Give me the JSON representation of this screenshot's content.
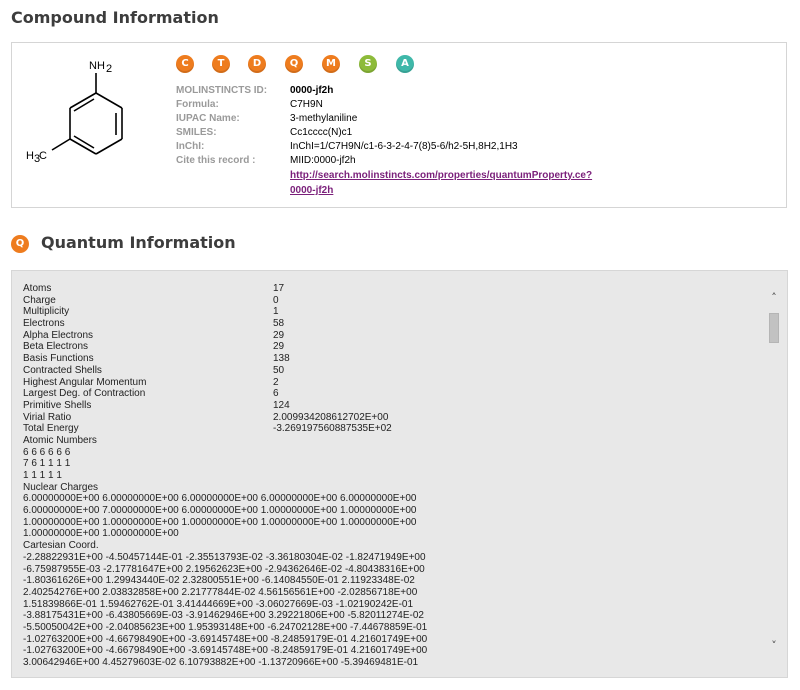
{
  "compound_section": {
    "title": "Compound Information"
  },
  "molecule": {
    "nh2_label": "NH",
    "nh2_sub": "2",
    "ch3_label": "H",
    "ch3_sub": "3",
    "ch3_c": "C"
  },
  "badges": [
    {
      "letter": "C",
      "color": "#ee7c1e"
    },
    {
      "letter": "T",
      "color": "#ee7c1e"
    },
    {
      "letter": "D",
      "color": "#ee7c1e"
    },
    {
      "letter": "Q",
      "color": "#ee7c1e"
    },
    {
      "letter": "M",
      "color": "#ee7c1e"
    },
    {
      "letter": "S",
      "color": "#8dbb3a"
    },
    {
      "letter": "A",
      "color": "#3fb8a9"
    }
  ],
  "info": {
    "molinstincts_id_label": "MOLINSTINCTS ID:",
    "molinstincts_id": "0000-jf2h",
    "formula_label": "Formula:",
    "formula": "C7H9N",
    "iupac_label": "IUPAC Name:",
    "iupac": "3-methylaniline",
    "smiles_label": "SMILES:",
    "smiles": "Cc1cccc(N)c1",
    "inchi_label": "InChI:",
    "inchi": "InChI=1/C7H9N/c1-6-3-2-4-7(8)5-6/h2-5H,8H2,1H3",
    "cite_label": "Cite this record :",
    "cite": "MIID:0000-jf2h",
    "link_line1": "http://search.molinstincts.com/properties/quantumProperty.ce?",
    "link_line2": "0000-jf2h"
  },
  "quantum_section": {
    "icon_letter": "Q",
    "title": "Quantum Information"
  },
  "quantum": {
    "rows": [
      {
        "key": "Atoms",
        "value": "17"
      },
      {
        "key": "Charge",
        "value": "0"
      },
      {
        "key": "Multiplicity",
        "value": "1"
      },
      {
        "key": "Electrons",
        "value": "58"
      },
      {
        "key": "Alpha Electrons",
        "value": "29"
      },
      {
        "key": "Beta Electrons",
        "value": "29"
      },
      {
        "key": "Basis Functions",
        "value": "138"
      },
      {
        "key": "Contracted Shells",
        "value": "50"
      },
      {
        "key": "Highest Angular Momentum",
        "value": "2"
      },
      {
        "key": "Largest Deg. of Contraction",
        "value": "6"
      },
      {
        "key": "Primitive Shells",
        "value": "124"
      },
      {
        "key": "Virial Ratio",
        "value": "2.009934208612702E+00"
      },
      {
        "key": "Total Energy",
        "value": "-3.269197560887535E+02"
      }
    ],
    "atomic_numbers_label": "Atomic Numbers",
    "atomic_numbers": [
      "6 6 6 6 6 6",
      "7 6 1 1 1 1",
      "1 1 1 1 1"
    ],
    "nuclear_charges_label": "Nuclear Charges",
    "nuclear_charges": [
      "6.00000000E+00 6.00000000E+00 6.00000000E+00 6.00000000E+00 6.00000000E+00",
      "6.00000000E+00 7.00000000E+00 6.00000000E+00 1.00000000E+00 1.00000000E+00",
      "1.00000000E+00 1.00000000E+00 1.00000000E+00 1.00000000E+00 1.00000000E+00",
      "1.00000000E+00 1.00000000E+00"
    ],
    "cartesian_label": "Cartesian Coord.",
    "cartesian": [
      "-2.28822931E+00 -4.50457144E-01 -2.35513793E-02 -3.36180304E-02 -1.82471949E+00",
      "-6.75987955E-03 -2.17781647E+00 2.19562623E+00 -2.94362646E-02 -4.80438316E+00",
      "-1.80361626E+00 1.29943440E-02 2.32800551E+00 -6.14084550E-01 2.11923348E-02",
      "2.40254276E+00 2.03832858E+00 2.21777844E-02 4.56156561E+00 -2.02856718E+00",
      "1.51839866E-01 1.59462762E-01 3.41444669E+00 -3.06027669E-03 -1.02190242E-01",
      "-3.88175431E+00 -6.43805669E-03 -3.91462946E+00 3.29221806E+00 -5.82011274E-02",
      "-5.50050042E+00 -2.04085623E+00 1.95393148E+00 -6.24702128E+00 -7.44678859E-01",
      "-1.02763200E+00 -4.66798490E+00 -3.69145748E+00 -8.24859179E-01 4.21601749E+00",
      "-1.02763200E+00 -4.66798490E+00 -3.69145748E+00 -8.24859179E-01 4.21601749E+00",
      "3.00642946E+00 4.45279603E-02 6.10793882E+00 -1.13720966E+00 -5.39469481E-01"
    ]
  },
  "scrollbar": {
    "up_glyph": "˄",
    "down_glyph": "˅"
  }
}
